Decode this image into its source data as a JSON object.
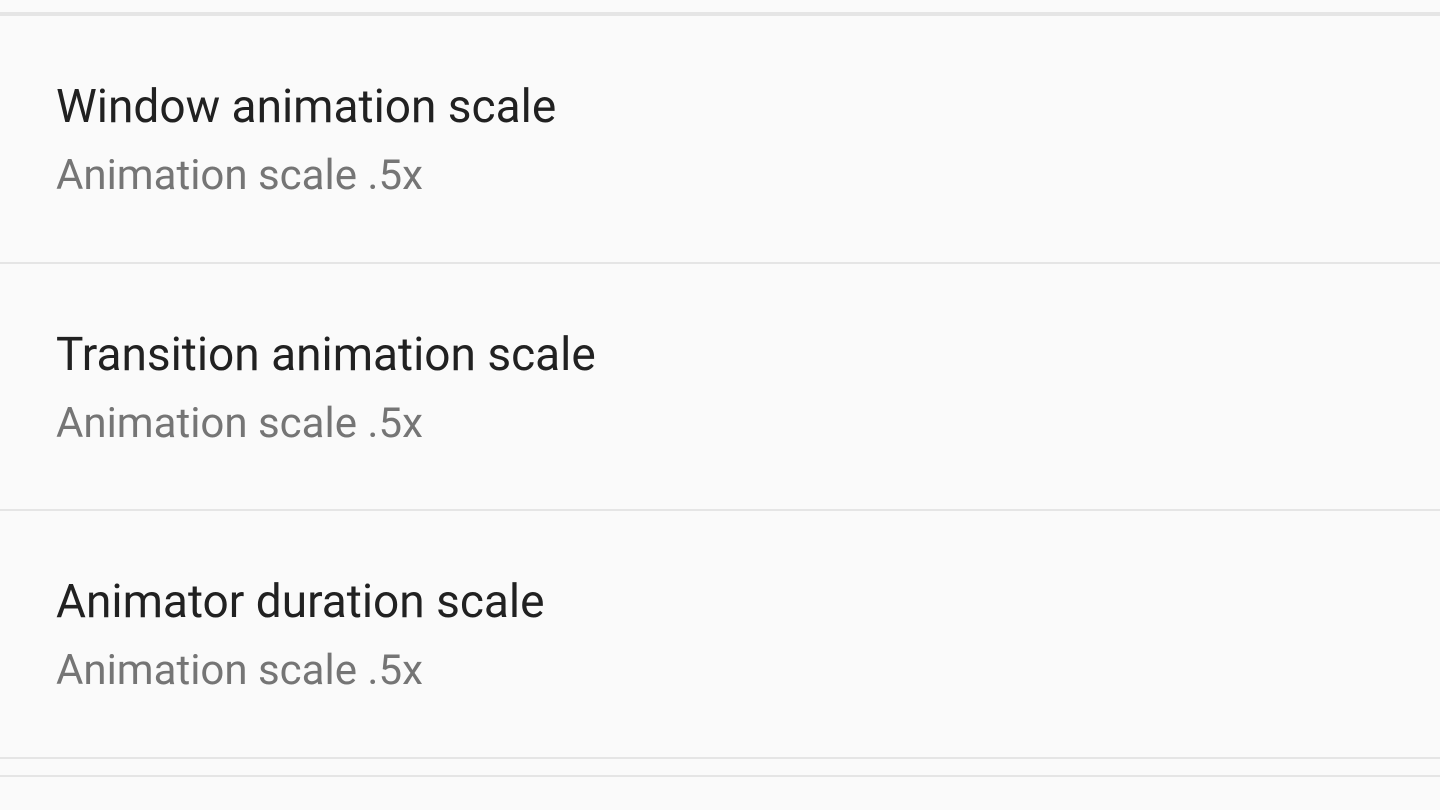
{
  "settings": {
    "items": [
      {
        "title": "Window animation scale",
        "subtitle": "Animation scale .5x"
      },
      {
        "title": "Transition animation scale",
        "subtitle": "Animation scale .5x"
      },
      {
        "title": "Animator duration scale",
        "subtitle": "Animation scale .5x"
      }
    ]
  }
}
